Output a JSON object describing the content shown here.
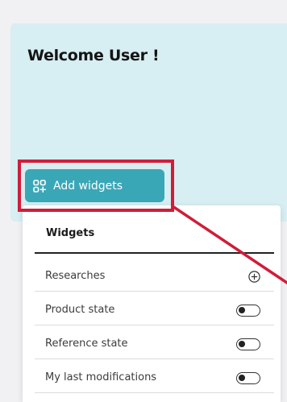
{
  "welcome": {
    "title": "Welcome User !"
  },
  "add_widgets": {
    "label": "Add widgets",
    "icon": "widgets-add-icon"
  },
  "widgets_panel": {
    "title": "Widgets",
    "items": [
      {
        "label": "Researches",
        "control": "add",
        "icon": "plus-circle-icon"
      },
      {
        "label": "Product state",
        "control": "toggle",
        "enabled": false
      },
      {
        "label": "Reference state",
        "control": "toggle",
        "enabled": false
      },
      {
        "label": "My last modifications",
        "control": "toggle",
        "enabled": false
      }
    ]
  },
  "colors": {
    "card_background": "#d7eef2",
    "button_accent": "#3aa7b7",
    "highlight": "#d21c3a"
  }
}
